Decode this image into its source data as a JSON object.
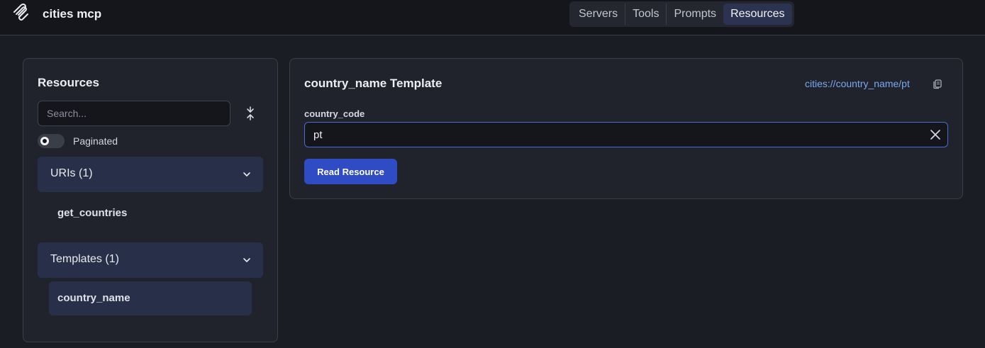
{
  "app": {
    "title": "cities mcp",
    "logo_icon": "mcp-logo-icon"
  },
  "nav": {
    "tabs": [
      {
        "label": "Servers",
        "active": false
      },
      {
        "label": "Tools",
        "active": false
      },
      {
        "label": "Prompts",
        "active": false
      },
      {
        "label": "Resources",
        "active": true
      }
    ]
  },
  "sidebar": {
    "heading": "Resources",
    "search": {
      "placeholder": "Search...",
      "value": ""
    },
    "paginated": {
      "label": "Paginated",
      "enabled": false
    },
    "sections": [
      {
        "label": "URIs (1)",
        "expanded": true,
        "items": [
          "get_countries"
        ]
      },
      {
        "label": "Templates (1)",
        "expanded": true,
        "items": [
          "country_name"
        ],
        "selected": "country_name"
      }
    ]
  },
  "detail": {
    "title": "country_name Template",
    "uri": "cities://country_name/pt",
    "param_label": "country_code",
    "param_value": "pt",
    "action_label": "Read Resource"
  },
  "colors": {
    "background": "#1b1d24",
    "panel": "#20232b",
    "accent": "#2f4cc4",
    "link": "#7aa8f0",
    "selected": "#283049"
  }
}
